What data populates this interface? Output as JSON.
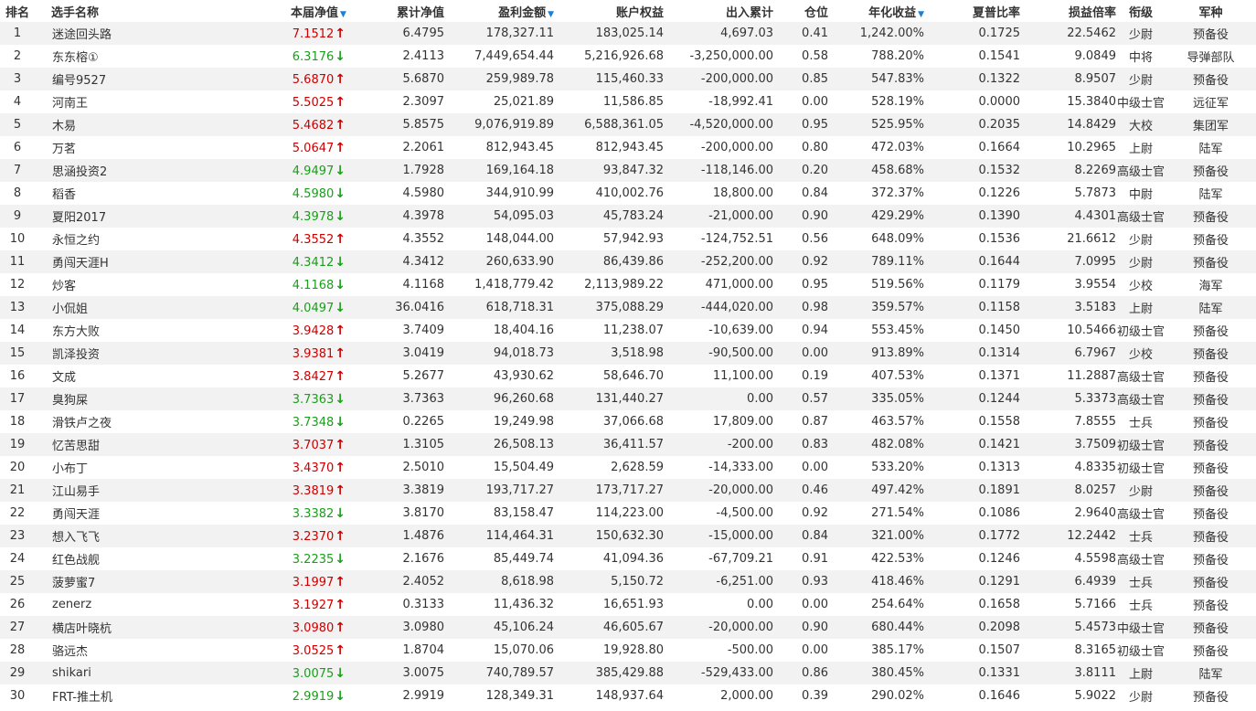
{
  "headers": {
    "rank": "排名",
    "name": "选手名称",
    "nav": "本届净值",
    "cum_nav": "累计净值",
    "profit": "盈利金额",
    "equity": "账户权益",
    "inout": "出入累计",
    "position": "仓位",
    "annual": "年化收益",
    "sharpe": "夏普比率",
    "pl_ratio": "损益倍率",
    "rank_title": "衔级",
    "branch": "军种"
  },
  "sort_indicator": "▼",
  "colors": {
    "up": "#cc0000",
    "down": "#1b9e1b",
    "sort_arrow": "#1a7fd6"
  },
  "rows": [
    {
      "rank": "1",
      "name": "迷途回头路",
      "nav": "7.1512",
      "dir": "up",
      "cum_nav": "6.4795",
      "profit": "178,327.11",
      "equity": "183,025.14",
      "inout": "4,697.03",
      "position": "0.41",
      "annual": "1,242.00%",
      "sharpe": "0.1725",
      "pl_ratio": "22.5462",
      "title": "少尉",
      "branch": "预备役"
    },
    {
      "rank": "2",
      "name": "东东榕①",
      "nav": "6.3176",
      "dir": "down",
      "cum_nav": "2.4113",
      "profit": "7,449,654.44",
      "equity": "5,216,926.68",
      "inout": "-3,250,000.00",
      "position": "0.58",
      "annual": "788.20%",
      "sharpe": "0.1541",
      "pl_ratio": "9.0849",
      "title": "中将",
      "branch": "导弹部队"
    },
    {
      "rank": "3",
      "name": "编号9527",
      "nav": "5.6870",
      "dir": "up",
      "cum_nav": "5.6870",
      "profit": "259,989.78",
      "equity": "115,460.33",
      "inout": "-200,000.00",
      "position": "0.85",
      "annual": "547.83%",
      "sharpe": "0.1322",
      "pl_ratio": "8.9507",
      "title": "少尉",
      "branch": "预备役"
    },
    {
      "rank": "4",
      "name": "河南王",
      "nav": "5.5025",
      "dir": "up",
      "cum_nav": "2.3097",
      "profit": "25,021.89",
      "equity": "11,586.85",
      "inout": "-18,992.41",
      "position": "0.00",
      "annual": "528.19%",
      "sharpe": "0.0000",
      "pl_ratio": "15.3840",
      "title": "中级士官",
      "branch": "远征军"
    },
    {
      "rank": "5",
      "name": "木易",
      "nav": "5.4682",
      "dir": "up",
      "cum_nav": "5.8575",
      "profit": "9,076,919.89",
      "equity": "6,588,361.05",
      "inout": "-4,520,000.00",
      "position": "0.95",
      "annual": "525.95%",
      "sharpe": "0.2035",
      "pl_ratio": "14.8429",
      "title": "大校",
      "branch": "集团军"
    },
    {
      "rank": "6",
      "name": "万茗",
      "nav": "5.0647",
      "dir": "up",
      "cum_nav": "2.2061",
      "profit": "812,943.45",
      "equity": "812,943.45",
      "inout": "-200,000.00",
      "position": "0.80",
      "annual": "472.03%",
      "sharpe": "0.1664",
      "pl_ratio": "10.2965",
      "title": "上尉",
      "branch": "陆军"
    },
    {
      "rank": "7",
      "name": "思涵投资2",
      "nav": "4.9497",
      "dir": "down",
      "cum_nav": "1.7928",
      "profit": "169,164.18",
      "equity": "93,847.32",
      "inout": "-118,146.00",
      "position": "0.20",
      "annual": "458.68%",
      "sharpe": "0.1532",
      "pl_ratio": "8.2269",
      "title": "高级士官",
      "branch": "预备役"
    },
    {
      "rank": "8",
      "name": "稻香",
      "nav": "4.5980",
      "dir": "down",
      "cum_nav": "4.5980",
      "profit": "344,910.99",
      "equity": "410,002.76",
      "inout": "18,800.00",
      "position": "0.84",
      "annual": "372.37%",
      "sharpe": "0.1226",
      "pl_ratio": "5.7873",
      "title": "中尉",
      "branch": "陆军"
    },
    {
      "rank": "9",
      "name": "夏阳2017",
      "nav": "4.3978",
      "dir": "down",
      "cum_nav": "4.3978",
      "profit": "54,095.03",
      "equity": "45,783.24",
      "inout": "-21,000.00",
      "position": "0.90",
      "annual": "429.29%",
      "sharpe": "0.1390",
      "pl_ratio": "4.4301",
      "title": "高级士官",
      "branch": "预备役"
    },
    {
      "rank": "10",
      "name": "永恒之约",
      "nav": "4.3552",
      "dir": "up",
      "cum_nav": "4.3552",
      "profit": "148,044.00",
      "equity": "57,942.93",
      "inout": "-124,752.51",
      "position": "0.56",
      "annual": "648.09%",
      "sharpe": "0.1536",
      "pl_ratio": "21.6612",
      "title": "少尉",
      "branch": "预备役"
    },
    {
      "rank": "11",
      "name": "勇闯天涯H",
      "nav": "4.3412",
      "dir": "down",
      "cum_nav": "4.3412",
      "profit": "260,633.90",
      "equity": "86,439.86",
      "inout": "-252,200.00",
      "position": "0.92",
      "annual": "789.11%",
      "sharpe": "0.1644",
      "pl_ratio": "7.0995",
      "title": "少尉",
      "branch": "预备役"
    },
    {
      "rank": "12",
      "name": "炒客",
      "nav": "4.1168",
      "dir": "down",
      "cum_nav": "4.1168",
      "profit": "1,418,779.42",
      "equity": "2,113,989.22",
      "inout": "471,000.00",
      "position": "0.95",
      "annual": "519.56%",
      "sharpe": "0.1179",
      "pl_ratio": "3.9554",
      "title": "少校",
      "branch": "海军"
    },
    {
      "rank": "13",
      "name": "小侃姐",
      "nav": "4.0497",
      "dir": "down",
      "cum_nav": "36.0416",
      "profit": "618,718.31",
      "equity": "375,088.29",
      "inout": "-444,020.00",
      "position": "0.98",
      "annual": "359.57%",
      "sharpe": "0.1158",
      "pl_ratio": "3.5183",
      "title": "上尉",
      "branch": "陆军"
    },
    {
      "rank": "14",
      "name": "东方大败",
      "nav": "3.9428",
      "dir": "up",
      "cum_nav": "3.7409",
      "profit": "18,404.16",
      "equity": "11,238.07",
      "inout": "-10,639.00",
      "position": "0.94",
      "annual": "553.45%",
      "sharpe": "0.1450",
      "pl_ratio": "10.5466",
      "title": "初级士官",
      "branch": "预备役"
    },
    {
      "rank": "15",
      "name": "凯泽投资",
      "nav": "3.9381",
      "dir": "up",
      "cum_nav": "3.0419",
      "profit": "94,018.73",
      "equity": "3,518.98",
      "inout": "-90,500.00",
      "position": "0.00",
      "annual": "913.89%",
      "sharpe": "0.1314",
      "pl_ratio": "6.7967",
      "title": "少校",
      "branch": "预备役"
    },
    {
      "rank": "16",
      "name": "文成",
      "nav": "3.8427",
      "dir": "up",
      "cum_nav": "5.2677",
      "profit": "43,930.62",
      "equity": "58,646.70",
      "inout": "11,100.00",
      "position": "0.19",
      "annual": "407.53%",
      "sharpe": "0.1371",
      "pl_ratio": "11.2887",
      "title": "高级士官",
      "branch": "预备役"
    },
    {
      "rank": "17",
      "name": "臭狗屎",
      "nav": "3.7363",
      "dir": "down",
      "cum_nav": "3.7363",
      "profit": "96,260.68",
      "equity": "131,440.27",
      "inout": "0.00",
      "position": "0.57",
      "annual": "335.05%",
      "sharpe": "0.1244",
      "pl_ratio": "5.3373",
      "title": "高级士官",
      "branch": "预备役"
    },
    {
      "rank": "18",
      "name": "滑铁卢之夜",
      "nav": "3.7348",
      "dir": "down",
      "cum_nav": "0.2265",
      "profit": "19,249.98",
      "equity": "37,066.68",
      "inout": "17,809.00",
      "position": "0.87",
      "annual": "463.57%",
      "sharpe": "0.1558",
      "pl_ratio": "7.8555",
      "title": "士兵",
      "branch": "预备役"
    },
    {
      "rank": "19",
      "name": "忆苦思甜",
      "nav": "3.7037",
      "dir": "up",
      "cum_nav": "1.3105",
      "profit": "26,508.13",
      "equity": "36,411.57",
      "inout": "-200.00",
      "position": "0.83",
      "annual": "482.08%",
      "sharpe": "0.1421",
      "pl_ratio": "3.7509",
      "title": "初级士官",
      "branch": "预备役"
    },
    {
      "rank": "20",
      "name": "小布丁",
      "nav": "3.4370",
      "dir": "up",
      "cum_nav": "2.5010",
      "profit": "15,504.49",
      "equity": "2,628.59",
      "inout": "-14,333.00",
      "position": "0.00",
      "annual": "533.20%",
      "sharpe": "0.1313",
      "pl_ratio": "4.8335",
      "title": "初级士官",
      "branch": "预备役"
    },
    {
      "rank": "21",
      "name": "江山易手",
      "nav": "3.3819",
      "dir": "up",
      "cum_nav": "3.3819",
      "profit": "193,717.27",
      "equity": "173,717.27",
      "inout": "-20,000.00",
      "position": "0.46",
      "annual": "497.42%",
      "sharpe": "0.1891",
      "pl_ratio": "8.0257",
      "title": "少尉",
      "branch": "预备役"
    },
    {
      "rank": "22",
      "name": "勇闯天涯",
      "nav": "3.3382",
      "dir": "down",
      "cum_nav": "3.8170",
      "profit": "83,158.47",
      "equity": "114,223.00",
      "inout": "-4,500.00",
      "position": "0.92",
      "annual": "271.54%",
      "sharpe": "0.1086",
      "pl_ratio": "2.9640",
      "title": "高级士官",
      "branch": "预备役"
    },
    {
      "rank": "23",
      "name": "想入飞飞",
      "nav": "3.2370",
      "dir": "up",
      "cum_nav": "1.4876",
      "profit": "114,464.31",
      "equity": "150,632.30",
      "inout": "-15,000.00",
      "position": "0.84",
      "annual": "321.00%",
      "sharpe": "0.1772",
      "pl_ratio": "12.2442",
      "title": "士兵",
      "branch": "预备役"
    },
    {
      "rank": "24",
      "name": "红色战舰",
      "nav": "3.2235",
      "dir": "down",
      "cum_nav": "2.1676",
      "profit": "85,449.74",
      "equity": "41,094.36",
      "inout": "-67,709.21",
      "position": "0.91",
      "annual": "422.53%",
      "sharpe": "0.1246",
      "pl_ratio": "4.5598",
      "title": "高级士官",
      "branch": "预备役"
    },
    {
      "rank": "25",
      "name": "菠萝蜜7",
      "nav": "3.1997",
      "dir": "up",
      "cum_nav": "2.4052",
      "profit": "8,618.98",
      "equity": "5,150.72",
      "inout": "-6,251.00",
      "position": "0.93",
      "annual": "418.46%",
      "sharpe": "0.1291",
      "pl_ratio": "6.4939",
      "title": "士兵",
      "branch": "预备役"
    },
    {
      "rank": "26",
      "name": "zenerz",
      "nav": "3.1927",
      "dir": "up",
      "cum_nav": "0.3133",
      "profit": "11,436.32",
      "equity": "16,651.93",
      "inout": "0.00",
      "position": "0.00",
      "annual": "254.64%",
      "sharpe": "0.1658",
      "pl_ratio": "5.7166",
      "title": "士兵",
      "branch": "预备役"
    },
    {
      "rank": "27",
      "name": "横店叶晓杭",
      "nav": "3.0980",
      "dir": "up",
      "cum_nav": "3.0980",
      "profit": "45,106.24",
      "equity": "46,605.67",
      "inout": "-20,000.00",
      "position": "0.90",
      "annual": "680.44%",
      "sharpe": "0.2098",
      "pl_ratio": "5.4573",
      "title": "中级士官",
      "branch": "预备役"
    },
    {
      "rank": "28",
      "name": "骆远杰",
      "nav": "3.0525",
      "dir": "up",
      "cum_nav": "1.8704",
      "profit": "15,070.06",
      "equity": "19,928.80",
      "inout": "-500.00",
      "position": "0.00",
      "annual": "385.17%",
      "sharpe": "0.1507",
      "pl_ratio": "8.3165",
      "title": "初级士官",
      "branch": "预备役"
    },
    {
      "rank": "29",
      "name": "shikari",
      "nav": "3.0075",
      "dir": "down",
      "cum_nav": "3.0075",
      "profit": "740,789.57",
      "equity": "385,429.88",
      "inout": "-529,433.00",
      "position": "0.86",
      "annual": "380.45%",
      "sharpe": "0.1331",
      "pl_ratio": "3.8111",
      "title": "上尉",
      "branch": "陆军"
    },
    {
      "rank": "30",
      "name": "FRT-推土机",
      "nav": "2.9919",
      "dir": "down",
      "cum_nav": "2.9919",
      "profit": "128,349.31",
      "equity": "148,937.64",
      "inout": "2,000.00",
      "position": "0.39",
      "annual": "290.02%",
      "sharpe": "0.1646",
      "pl_ratio": "5.9022",
      "title": "少尉",
      "branch": "预备役"
    }
  ]
}
